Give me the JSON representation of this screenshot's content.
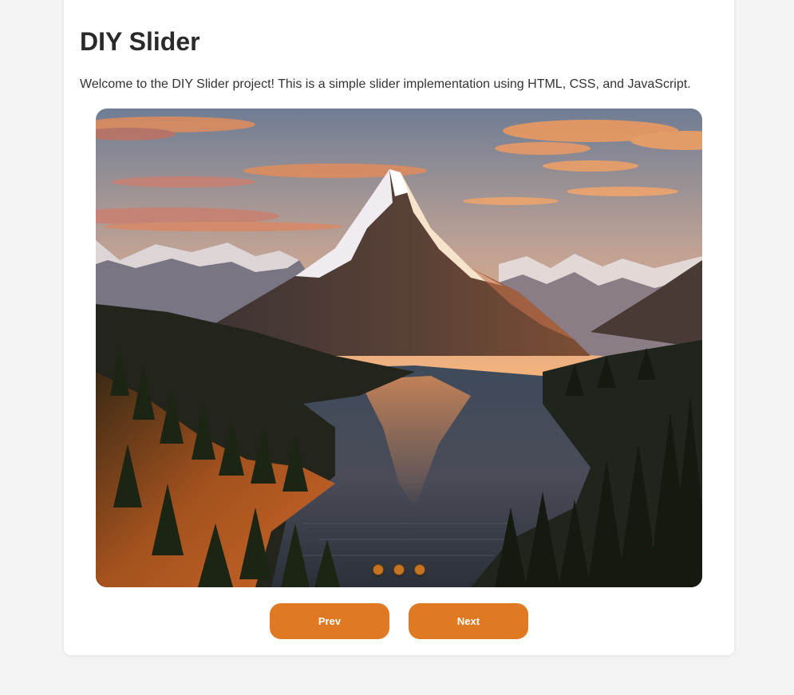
{
  "page": {
    "title": "DIY Slider",
    "intro": "Welcome to the DIY Slider project! This is a simple slider implementation using HTML, CSS, and JavaScript."
  },
  "slider": {
    "image": "mountain-lake-sunset-image",
    "slide_count": 3,
    "active_index": 0
  },
  "controls": {
    "prev_label": "Prev",
    "next_label": "Next"
  },
  "colors": {
    "accent": "#e07a22",
    "page_background": "#f4f4f4",
    "card_background": "#ffffff",
    "dot": "#c57422"
  }
}
